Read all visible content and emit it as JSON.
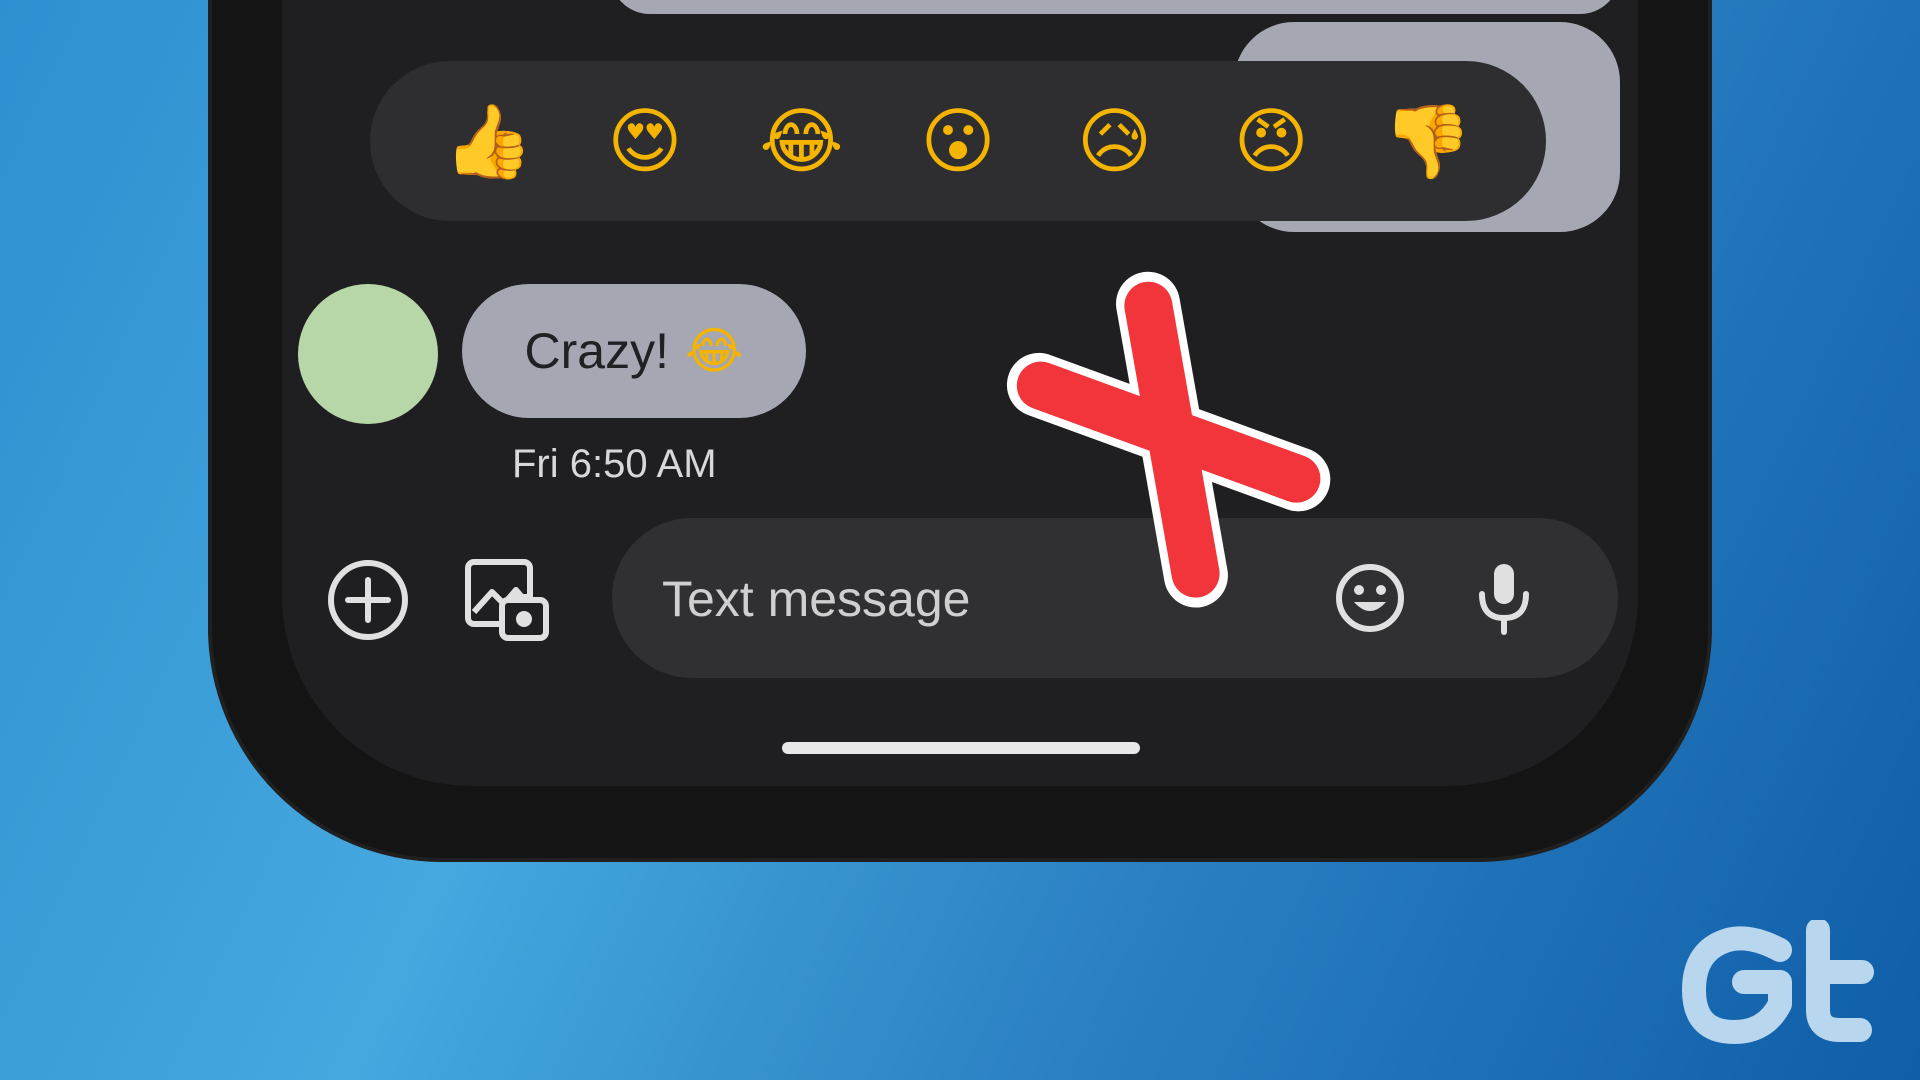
{
  "reactions": [
    {
      "name": "thumbs-up",
      "glyph": "👍"
    },
    {
      "name": "heart-eyes",
      "glyph": "😍"
    },
    {
      "name": "tears-of-joy",
      "glyph": "😂"
    },
    {
      "name": "surprised",
      "glyph": "😮"
    },
    {
      "name": "sad-sweat",
      "glyph": "😥"
    },
    {
      "name": "angry",
      "glyph": "😠"
    },
    {
      "name": "thumbs-down",
      "glyph": "👎"
    }
  ],
  "message": {
    "text": "Crazy!",
    "emoji": "😂",
    "timestamp": "Fri 6:50 AM"
  },
  "compose": {
    "placeholder": "Text message"
  },
  "icons": {
    "add": "add-circle-icon",
    "gallery": "gallery-camera-icon",
    "emoji": "emoji-icon",
    "mic": "microphone-icon"
  },
  "colors": {
    "background_start": "#2f8fd0",
    "background_end": "#0f5ea8",
    "screen": "#1f1f21",
    "bubble": "#a5a8b2",
    "avatar": "#b7d7a8",
    "cross": "#f2353b"
  }
}
